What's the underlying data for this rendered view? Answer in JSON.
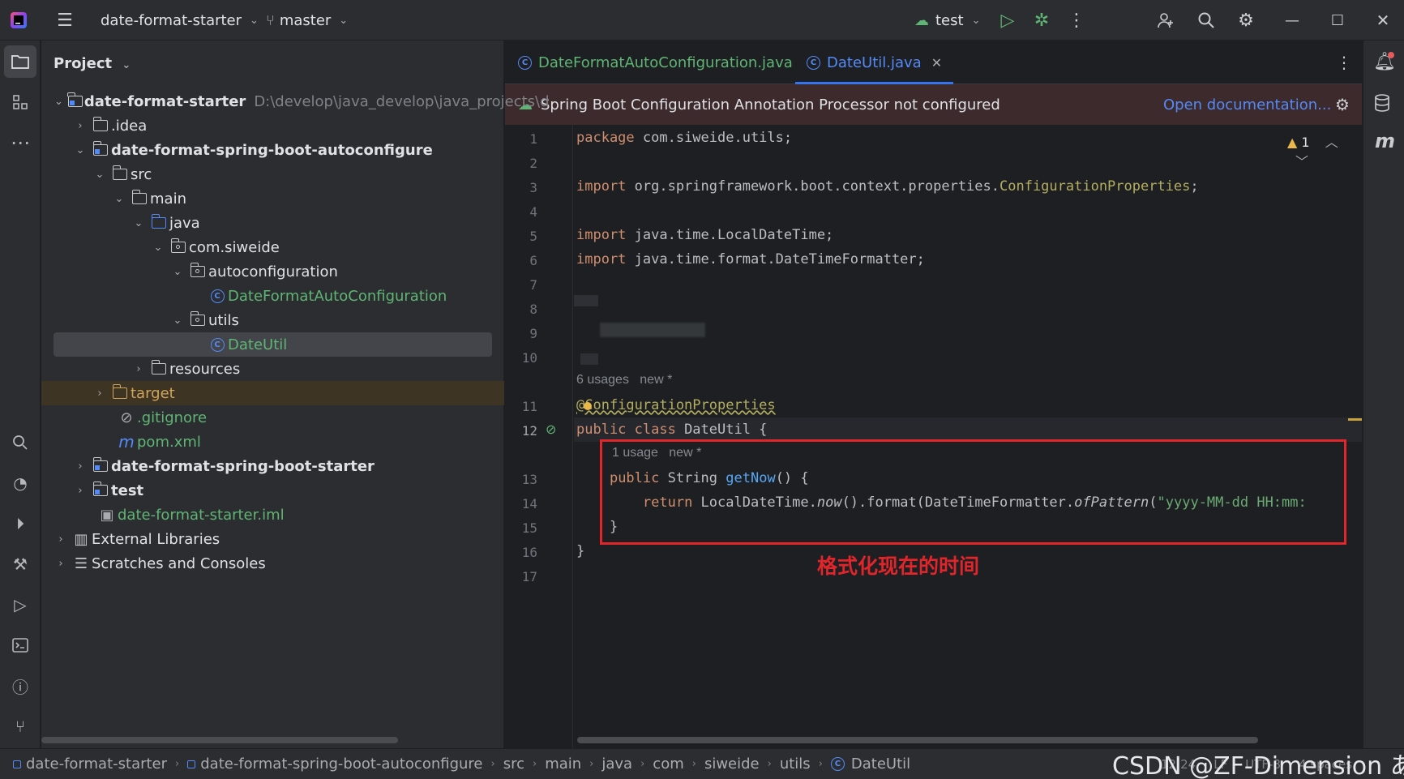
{
  "titlebar": {
    "project_name": "date-format-starter",
    "branch": "master",
    "run_config": "test"
  },
  "project_panel": {
    "title": "Project",
    "root_path": "D:\\develop\\java_develop\\java_projects\\d",
    "items": [
      {
        "label": "date-format-starter"
      },
      {
        "label": ".idea"
      },
      {
        "label": "date-format-spring-boot-autoconfigure"
      },
      {
        "label": "src"
      },
      {
        "label": "main"
      },
      {
        "label": "java"
      },
      {
        "label": "com.siweide"
      },
      {
        "label": "autoconfiguration"
      },
      {
        "label": "DateFormatAutoConfiguration"
      },
      {
        "label": "utils"
      },
      {
        "label": "DateUtil"
      },
      {
        "label": "resources"
      },
      {
        "label": "target"
      },
      {
        "label": ".gitignore"
      },
      {
        "label": "pom.xml"
      },
      {
        "label": "date-format-spring-boot-starter"
      },
      {
        "label": "test"
      },
      {
        "label": "date-format-starter.iml"
      },
      {
        "label": "External Libraries"
      },
      {
        "label": "Scratches and Consoles"
      }
    ]
  },
  "tabs": [
    {
      "label": "DateFormatAutoConfiguration.java"
    },
    {
      "label": "DateUtil.java"
    }
  ],
  "banner": {
    "message": "Spring Boot Configuration Annotation Processor not configured",
    "link": "Open documentation..."
  },
  "editor": {
    "warning_count": "1",
    "line_numbers": [
      "1",
      "2",
      "3",
      "4",
      "5",
      "6",
      "7",
      "8",
      "9",
      "10",
      "11",
      "12",
      "13",
      "14",
      "15",
      "16",
      "17"
    ],
    "code": {
      "l1_kw": "package",
      "l1_rest": " com.siweide.utils;",
      "l3_kw": "import",
      "l3_rest": " org.springframework.boot.context.properties.",
      "l3_cls": "ConfigurationProperties",
      "l3_end": ";",
      "l5_kw": "import",
      "l5_rest": " java.time.LocalDateTime;",
      "l6_kw": "import",
      "l6_rest": " java.time.format.DateTimeFormatter;",
      "l11": "@ConfigurationProperties",
      "l12_kw": "public class",
      "l12_rest": " DateUtil {",
      "l13_kw": "public",
      "l13_type": " String ",
      "l13_fn": "getNow",
      "l13_end": "() {",
      "l14_kw": "return",
      "l14_a": " LocalDateTime.",
      "l14_now": "now",
      "l14_b": "().format(DateTimeFormatter.",
      "l14_of": "ofPattern",
      "l14_c": "(",
      "l14_str": "\"yyyy-MM-dd HH:mm:",
      "l15": "}",
      "l16": "}"
    },
    "hint_usages_class": "6 usages",
    "hint_new_class": "new *",
    "hint_usages_method": "1 usage",
    "hint_new_method": "new *",
    "annotation_text": "格式化现在的时间",
    "annotation_color": "#e0252b"
  },
  "statusbar": {
    "breadcrumbs": [
      "date-format-starter",
      "date-format-spring-boot-autoconfigure",
      "src",
      "main",
      "java",
      "com",
      "siweide",
      "utils",
      "DateUtil"
    ],
    "position": "12:24",
    "line_sep": "LF",
    "encoding": "UTF-8",
    "indent": "4 spaces"
  },
  "watermark": "CSDN @ZF-Dimension あ"
}
